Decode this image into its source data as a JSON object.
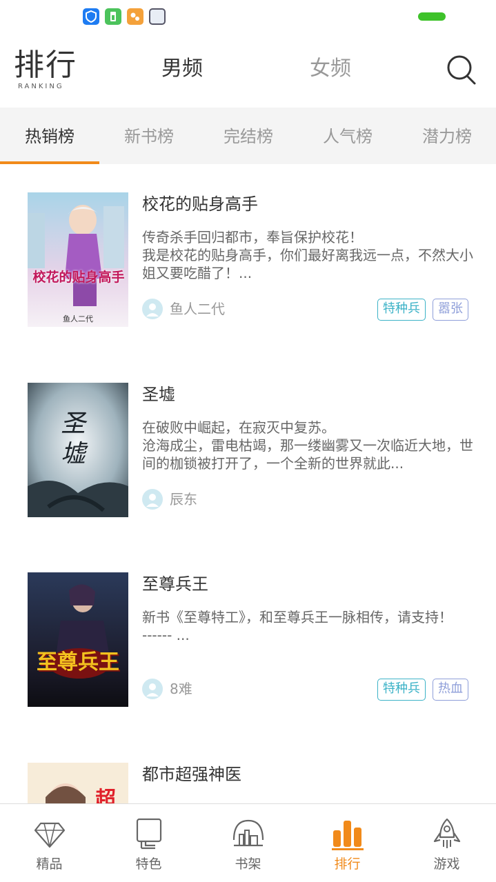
{
  "header": {
    "logo_cn": "排行",
    "logo_en": "RANKING",
    "gender_tabs": [
      "男频",
      "女频"
    ],
    "active_gender": "男频"
  },
  "rank_tabs": [
    "热销榜",
    "新书榜",
    "完结榜",
    "人气榜",
    "潜力榜"
  ],
  "active_rank_tab": "热销榜",
  "books": [
    {
      "title": "校花的贴身高手",
      "desc": "传奇杀手回归都市，奉旨保护校花！\n我是校花的贴身高手，你们最好离我远一点，不然大小姐又要吃醋了！...",
      "author": "鱼人二代",
      "tags": [
        "特种兵",
        "嚣张"
      ],
      "cover_text": "校花的贴身高手",
      "cover_author": "鱼人二代"
    },
    {
      "title": "圣墟",
      "desc": "在破败中崛起，在寂灭中复苏。\n沧海成尘，雷电枯竭，那一缕幽雾又一次临近大地，世间的枷锁被打开了，一个全新的世界就此...",
      "author": "辰东",
      "tags": [],
      "cover_text": "圣墟"
    },
    {
      "title": "至尊兵王",
      "desc": "新书《至尊特工》，和至尊兵王一脉相传，请支持！\n------ ...",
      "author": "8难",
      "tags": [
        "特种兵",
        "热血"
      ],
      "cover_text": "至尊兵王"
    },
    {
      "title": "都市超强神医",
      "cover_text": "超"
    }
  ],
  "bottom_nav": [
    "精品",
    "特色",
    "书架",
    "排行",
    "游戏"
  ],
  "active_nav": "排行",
  "colors": {
    "accent": "#f18a1a",
    "tag_teal": "#3bb2c7",
    "tag_lavender": "#8e9ed9",
    "battery": "#3ec22a"
  },
  "icons": {
    "status": [
      "shield-icon",
      "battery-saver-icon",
      "browser-icon",
      "square-icon",
      "battery-icon"
    ],
    "search": "search-icon",
    "nav": [
      "diamond-icon",
      "tablet-icon",
      "bookshelf-icon",
      "bar-chart-icon",
      "rocket-icon"
    ]
  }
}
